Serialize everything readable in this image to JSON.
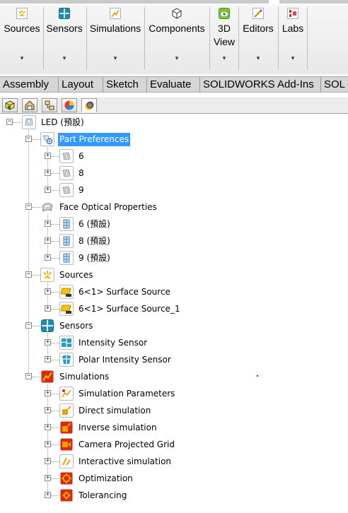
{
  "ribbon": {
    "buttons": [
      {
        "label": "Sources",
        "icon": "sources-icon"
      },
      {
        "label": "Sensors",
        "icon": "sensors-icon"
      },
      {
        "label": "Simulations",
        "icon": "simulations-icon"
      },
      {
        "label": "Components",
        "icon": "components-icon"
      },
      {
        "label": "3D\nView",
        "icon": "3d-view-icon"
      },
      {
        "label": "Editors",
        "icon": "editors-icon"
      },
      {
        "label": "Labs",
        "icon": "labs-icon"
      }
    ],
    "dropdown_glyph": "▾"
  },
  "command_tabs": [
    "Assembly",
    "Layout",
    "Sketch",
    "Evaluate",
    "SOLIDWORKS Add-Ins",
    "SOL"
  ],
  "panel_tabs": [
    "feature-manager-icon",
    "property-manager-icon",
    "configuration-manager-icon",
    "appearance-manager-icon",
    "speos-tree-icon"
  ],
  "tree": {
    "root": "LED (預設)",
    "part_preferences": {
      "label": "Part Preferences",
      "children": [
        "6",
        "8",
        "9"
      ]
    },
    "face_optical_properties": {
      "label": "Face Optical Properties",
      "children": [
        "6 (預設)",
        "8 (預設)",
        "9 (預設)"
      ]
    },
    "sources": {
      "label": "Sources",
      "children": [
        "6<1> Surface Source",
        "6<1> Surface Source_1"
      ]
    },
    "sensors": {
      "label": "Sensors",
      "children": [
        "Intensity Sensor",
        "Polar Intensity Sensor"
      ]
    },
    "simulations": {
      "label": "Simulations",
      "children": [
        "Simulation Parameters",
        "Direct simulation",
        "Inverse simulation",
        "Camera Projected Grid",
        "Interactive simulation",
        "Optimization",
        "Tolerancing"
      ]
    },
    "expand_glyph": "+",
    "collapse_glyph": "−"
  },
  "colors": {
    "selection": "#3399ff",
    "accent_red": "#d62b10",
    "accent_yellow": "#f5c400",
    "accent_teal": "#1c8fb0"
  }
}
